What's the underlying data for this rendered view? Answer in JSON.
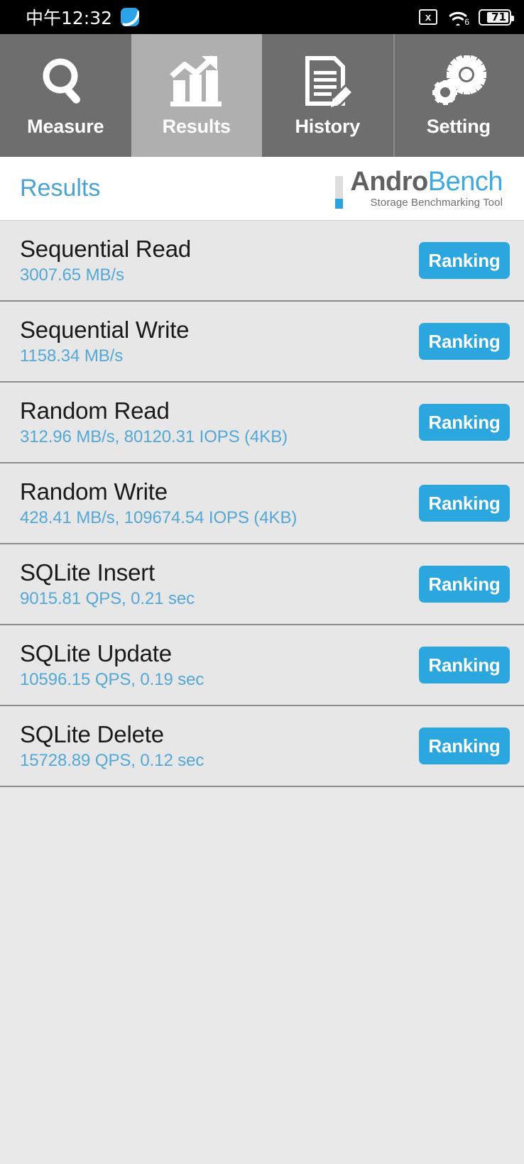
{
  "status_bar": {
    "time": "中午12:32",
    "app_icon": "app-badge-icon",
    "sim_icon_label": "x",
    "sim_icon": "sim-card-off-icon",
    "wifi_icon": "wifi-icon",
    "wifi_generation": "6",
    "battery_icon": "battery-icon",
    "battery_level": "71"
  },
  "tabs": [
    {
      "label": "Measure",
      "icon": "magnifier-icon",
      "active": false
    },
    {
      "label": "Results",
      "icon": "bar-chart-arrow-icon",
      "active": true
    },
    {
      "label": "History",
      "icon": "document-pencil-icon",
      "active": false
    },
    {
      "label": "Setting",
      "icon": "gears-icon",
      "active": false
    }
  ],
  "header": {
    "title": "Results",
    "brand_first": "Andro",
    "brand_second": "Bench",
    "brand_tagline": "Storage Benchmarking Tool"
  },
  "results": [
    {
      "title": "Sequential Read",
      "value": "3007.65 MB/s",
      "button": "Ranking"
    },
    {
      "title": "Sequential Write",
      "value": "1158.34 MB/s",
      "button": "Ranking"
    },
    {
      "title": "Random Read",
      "value": "312.96 MB/s, 80120.31 IOPS (4KB)",
      "button": "Ranking"
    },
    {
      "title": "Random Write",
      "value": "428.41 MB/s, 109674.54 IOPS (4KB)",
      "button": "Ranking"
    },
    {
      "title": "SQLite Insert",
      "value": "9015.81 QPS, 0.21 sec",
      "button": "Ranking"
    },
    {
      "title": "SQLite Update",
      "value": "10596.15 QPS, 0.19 sec",
      "button": "Ranking"
    },
    {
      "title": "SQLite Delete",
      "value": "15728.89 QPS, 0.12 sec",
      "button": "Ranking"
    }
  ],
  "colors": {
    "accent_blue": "#2ba6de",
    "value_blue": "#53a8d8",
    "title_blue": "#4aa3d4",
    "tab_inactive": "#6e6e6e",
    "tab_active": "#afafaf",
    "list_background": "#e7e7e7",
    "status_bar": "#000000"
  }
}
